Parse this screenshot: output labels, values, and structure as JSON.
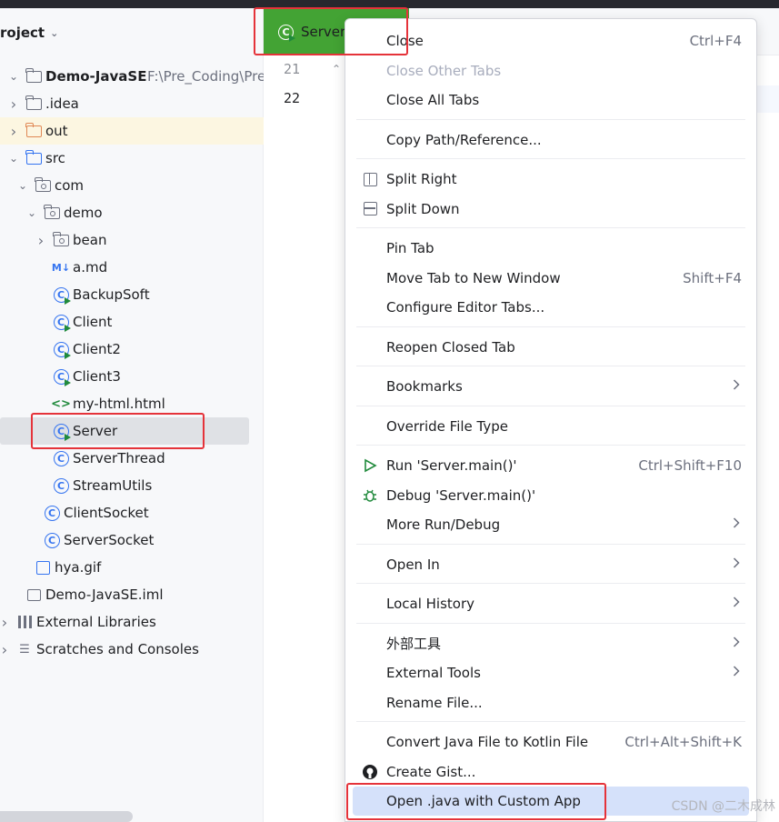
{
  "project_panel": {
    "title": "roject",
    "tree": [
      {
        "label": "Demo-JavaSE",
        "extra": "F:\\Pre_Coding\\Pre_",
        "icon": "module-folder-icon",
        "indent": 1,
        "arrow": "down"
      },
      {
        "label": ".idea",
        "icon": "folder-icon",
        "indent": 1,
        "arrow": "right"
      },
      {
        "label": "out",
        "icon": "folder-orange-icon",
        "indent": 1,
        "arrow": "right"
      },
      {
        "label": "src",
        "icon": "source-folder-icon",
        "indent": 1,
        "arrow": "down"
      },
      {
        "label": "com",
        "icon": "package-icon",
        "indent": 2,
        "arrow": "down"
      },
      {
        "label": "demo",
        "icon": "package-icon",
        "indent": 3,
        "arrow": "down"
      },
      {
        "label": "bean",
        "icon": "package-icon",
        "indent": 4,
        "arrow": "right"
      },
      {
        "label": "a.md",
        "icon": "markdown-icon",
        "indent": 4
      },
      {
        "label": "BackupSoft",
        "icon": "class-run-icon",
        "indent": 4
      },
      {
        "label": "Client",
        "icon": "class-run-icon",
        "indent": 4
      },
      {
        "label": "Client2",
        "icon": "class-run-icon",
        "indent": 4
      },
      {
        "label": "Client3",
        "icon": "class-run-icon",
        "indent": 4
      },
      {
        "label": "my-html.html",
        "icon": "html-icon",
        "indent": 4
      },
      {
        "label": "Server",
        "icon": "class-run-icon",
        "indent": 4
      },
      {
        "label": "ServerThread",
        "icon": "class-icon",
        "indent": 4
      },
      {
        "label": "StreamUtils",
        "icon": "class-icon",
        "indent": 4
      },
      {
        "label": "ClientSocket",
        "icon": "class-icon",
        "indent": 3
      },
      {
        "label": "ServerSocket",
        "icon": "class-icon",
        "indent": 3
      },
      {
        "label": "hya.gif",
        "icon": "image-icon",
        "indent": 2
      },
      {
        "label": "Demo-JavaSE.iml",
        "icon": "iml-icon",
        "indent": 1
      },
      {
        "label": "External Libraries",
        "icon": "libraries-icon",
        "indent": 0,
        "arrow": "right"
      },
      {
        "label": "Scratches and Consoles",
        "icon": "scratches-icon",
        "indent": 0,
        "arrow": "right"
      }
    ]
  },
  "editor": {
    "tab_label": "Server",
    "line_numbers": [
      "21",
      "22"
    ]
  },
  "context_menu": {
    "items": [
      {
        "label": "Close",
        "shortcut": "Ctrl+F4",
        "underline": "C"
      },
      {
        "label": "Close Other Tabs",
        "disabled": true
      },
      {
        "label": "Close All Tabs"
      },
      {
        "label": "Copy Path/Reference...",
        "separator_before": true
      },
      {
        "label": "Split Right",
        "icon": "split-right-icon",
        "separator_before": true
      },
      {
        "label": "Split Down",
        "icon": "split-down-icon"
      },
      {
        "label": "Pin Tab",
        "separator_before": true
      },
      {
        "label": "Move Tab to New Window",
        "shortcut": "Shift+F4"
      },
      {
        "label": "Configure Editor Tabs..."
      },
      {
        "label": "Reopen Closed Tab",
        "separator_before": true
      },
      {
        "label": "Bookmarks",
        "submenu": true,
        "separator_before": true
      },
      {
        "label": "Override File Type",
        "separator_before": true
      },
      {
        "label": "Run 'Server.main()'",
        "shortcut": "Ctrl+Shift+F10",
        "icon": "run-icon",
        "separator_before": true
      },
      {
        "label": "Debug 'Server.main()'",
        "icon": "debug-icon"
      },
      {
        "label": "More Run/Debug",
        "submenu": true
      },
      {
        "label": "Open In",
        "submenu": true,
        "separator_before": true
      },
      {
        "label": "Local History",
        "submenu": true,
        "separator_before": true
      },
      {
        "label": "外部工具",
        "submenu": true,
        "separator_before": true
      },
      {
        "label": "External Tools",
        "submenu": true
      },
      {
        "label": "Rename File..."
      },
      {
        "label": "Convert Java File to Kotlin File",
        "shortcut": "Ctrl+Alt+Shift+K",
        "separator_before": true
      },
      {
        "label": "Create Gist...",
        "icon": "github-icon"
      },
      {
        "label": "Open .java with Custom App",
        "highlighted": true
      }
    ]
  },
  "watermark": "CSDN @二木成林",
  "colors": {
    "tab_active": "#43a334",
    "highlight_box": "#e5333a",
    "menu_highlight": "#d5e1fa",
    "accent": "#3574f0"
  }
}
